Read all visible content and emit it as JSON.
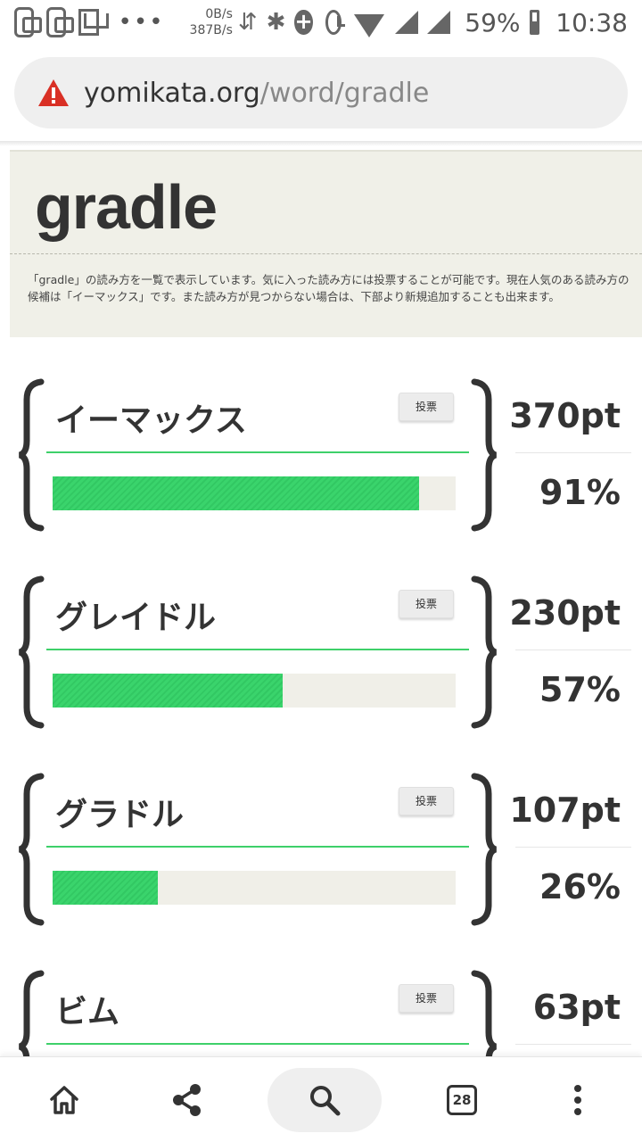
{
  "status_bar": {
    "net_up": "0B/s",
    "net_down": "387B/s",
    "battery": "59%",
    "time": "10:38"
  },
  "address_bar": {
    "domain": "yomikata.org",
    "path": "/word/gradle"
  },
  "page": {
    "word": "gradle",
    "description": "「gradle」の読み方を一覧で表示しています。気に入った読み方には投票することが可能です。現在人気のある読み方の候補は「イーマックス」です。また読み方が見つからない場合は、下部より新規追加することも出来ます。"
  },
  "readings": [
    {
      "name": "イーマックス",
      "vote_label": "投票",
      "points": "370pt",
      "percent": "91%",
      "fraction": 0.91
    },
    {
      "name": "グレイドル",
      "vote_label": "投票",
      "points": "230pt",
      "percent": "57%",
      "fraction": 0.57
    },
    {
      "name": "グラドル",
      "vote_label": "投票",
      "points": "107pt",
      "percent": "26%",
      "fraction": 0.26
    },
    {
      "name": "ビム",
      "vote_label": "投票",
      "points": "63pt",
      "percent": "",
      "fraction": null
    }
  ],
  "bottom_nav": {
    "tab_count": "28"
  },
  "colors": {
    "bar_green": "#3ad46c",
    "header_bg": "#f0f0e8",
    "warning_red": "#d93025"
  }
}
